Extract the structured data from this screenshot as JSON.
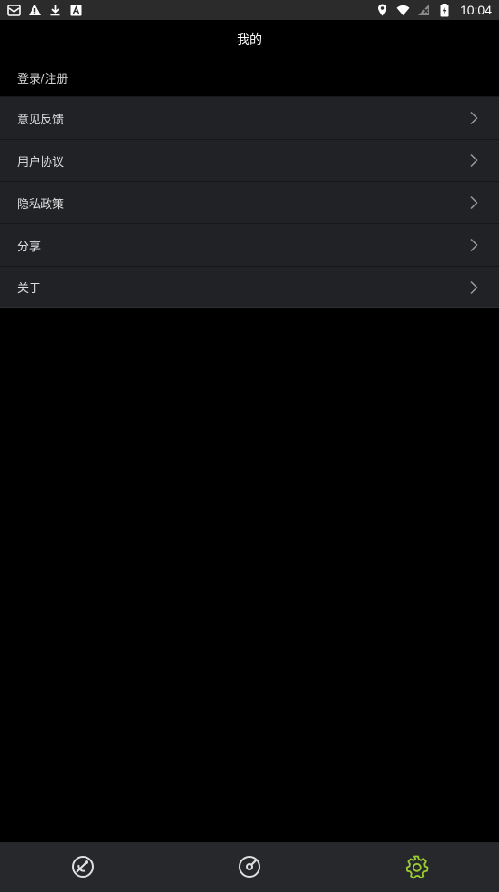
{
  "status_bar": {
    "time": "10:04",
    "left_icons": [
      "mail-icon",
      "warning-icon",
      "download-icon",
      "app-icon"
    ],
    "right_icons": [
      "location-icon",
      "wifi-icon",
      "signal-icon",
      "battery-icon"
    ]
  },
  "header": {
    "title": "我的"
  },
  "login": {
    "label": "登录/注册"
  },
  "menu": {
    "items": [
      {
        "label": "意见反馈"
      },
      {
        "label": "用户协议"
      },
      {
        "label": "隐私政策"
      },
      {
        "label": "分享"
      },
      {
        "label": "关于"
      }
    ]
  },
  "bottom_nav": {
    "tabs": [
      {
        "icon": "satellite-dish-icon",
        "active": false
      },
      {
        "icon": "speedometer-icon",
        "active": false
      },
      {
        "icon": "gear-icon",
        "active": true
      }
    ],
    "active_color": "#9acd32",
    "inactive_color": "#e0e0e0"
  },
  "colors": {
    "background": "#000000",
    "status_bar": "#2b2b2b",
    "list_background": "#202226",
    "bottom_nav": "#26282c"
  }
}
